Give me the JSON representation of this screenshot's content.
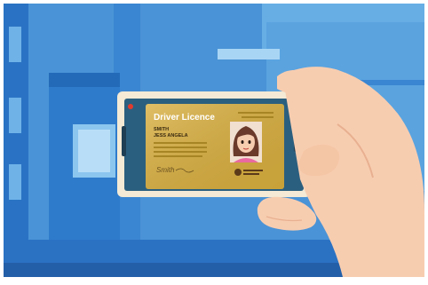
{
  "licence": {
    "title": "Driver Licence",
    "surname": "SMITH",
    "given_names": "JESS ANGELA",
    "signature": "Smith"
  },
  "colors": {
    "sky": "#4a93d6",
    "building_dark": "#2a73c4",
    "building_mid": "#3b86d2",
    "building_light": "#67aee5",
    "ground": "#2b72c3",
    "phone_body": "#f4ead5",
    "screen": "#2b5f7f",
    "card_gold": "#d8ae3d",
    "skin": "#f7cdb0",
    "hair": "#6b3a2a"
  },
  "icons": [
    "camera-icon",
    "recording-indicator-icon",
    "government-crest-icon"
  ]
}
